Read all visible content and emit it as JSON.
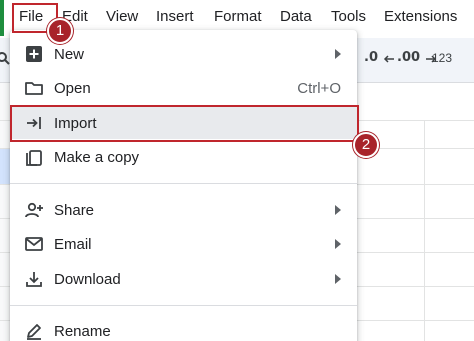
{
  "menubar": {
    "items": [
      {
        "label": "File"
      },
      {
        "label": "Edit"
      },
      {
        "label": "View"
      },
      {
        "label": "Insert"
      },
      {
        "label": "Format"
      },
      {
        "label": "Data"
      },
      {
        "label": "Tools"
      },
      {
        "label": "Extensions"
      }
    ]
  },
  "toolbar": {
    "decrease_decimal_label": ".0",
    "increase_decimal_label": ".00",
    "number_format_label": "123"
  },
  "file_menu": {
    "items": [
      {
        "label": "New",
        "icon": "add-box-icon",
        "submenu": true
      },
      {
        "label": "Open",
        "icon": "folder-icon",
        "shortcut": "Ctrl+O"
      },
      {
        "label": "Import",
        "icon": "import-arrow-icon"
      },
      {
        "label": "Make a copy",
        "icon": "copy-icon"
      },
      {
        "label": "Share",
        "icon": "person-add-icon",
        "submenu": true
      },
      {
        "label": "Email",
        "icon": "mail-icon",
        "submenu": true
      },
      {
        "label": "Download",
        "icon": "download-icon",
        "submenu": true
      },
      {
        "label": "Rename",
        "icon": "pencil-icon"
      }
    ]
  },
  "annotations": {
    "step1": "1",
    "step2": "2",
    "color": "#c0262d"
  }
}
